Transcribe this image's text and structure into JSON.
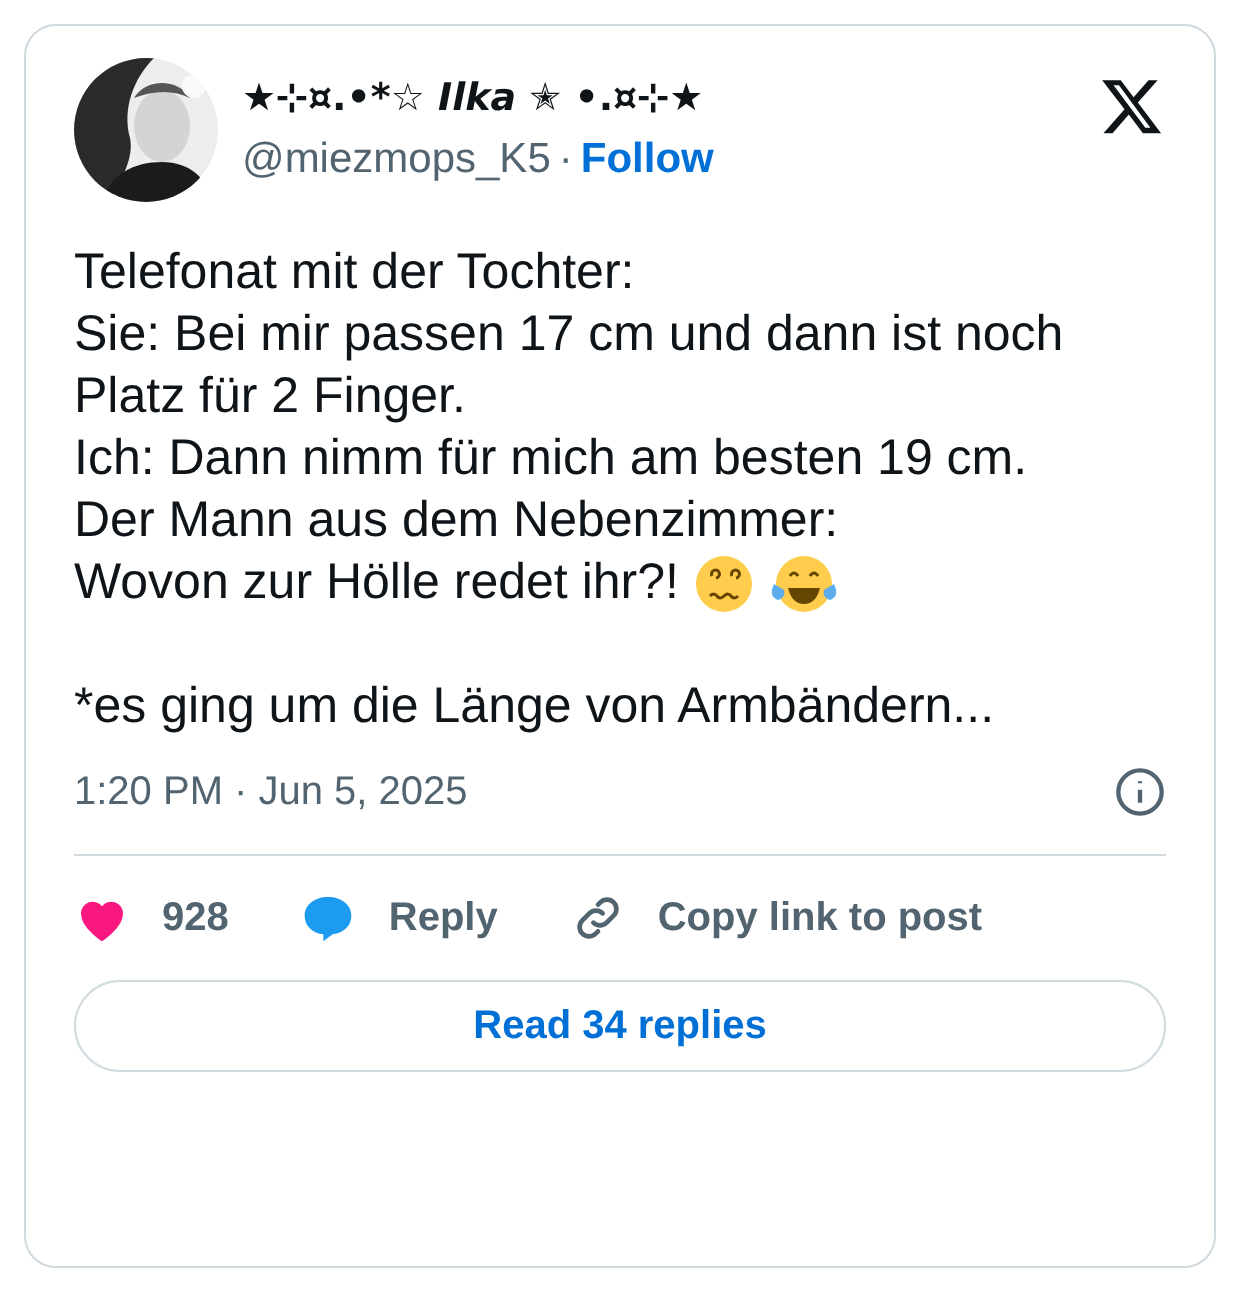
{
  "author": {
    "display_name": "★⊹¤.•*☆ *Ilka* ✭ •.¤⊹★",
    "handle": "@miezmops_K5",
    "separator": "·",
    "follow": "Follow"
  },
  "body": {
    "lines": [
      "Telefonat mit der Tochter:",
      "Sie: Bei mir passen 17 cm und dann ist noch Platz für 2 Finger.",
      "Ich: Dann nimm für mich am besten 19 cm.",
      "Der Mann aus dem Nebenzimmer:",
      "Wovon zur Hölle redet ihr?!"
    ],
    "footnote": "*es ging um die Länge von Armbändern..."
  },
  "timestamp": "1:20 PM · Jun 5, 2025",
  "actions": [
    {
      "kind": "like",
      "label": "928"
    },
    {
      "kind": "reply",
      "label": "Reply"
    },
    {
      "kind": "copy",
      "label": "Copy link to post"
    }
  ],
  "read_replies": "Read 34 replies"
}
